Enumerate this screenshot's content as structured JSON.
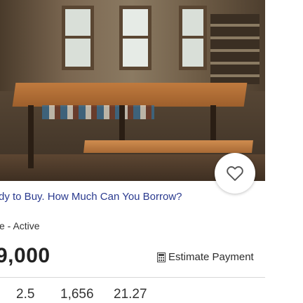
{
  "listing": {
    "promo_text": "dy to Buy. How Much Can You Borrow?",
    "status_text": "e - Active",
    "price": "9,000",
    "estimate_label": "Estimate Payment",
    "stats": {
      "baths": "2.5",
      "sqft": "1,656",
      "acres": "21.27"
    }
  },
  "icons": {
    "favorite": "heart-icon",
    "estimate": "calculator-icon"
  },
  "colors": {
    "promo_link": "#2a3a8f",
    "heart_stroke": "#555555"
  }
}
